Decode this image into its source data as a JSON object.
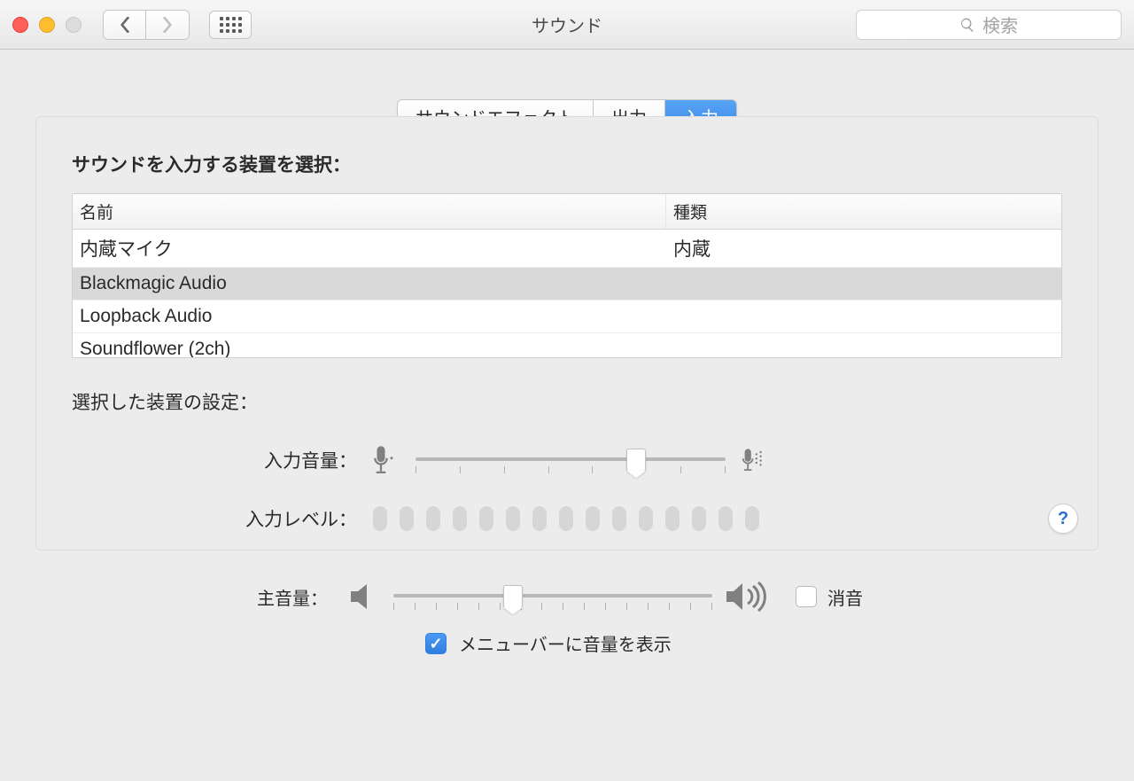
{
  "window": {
    "title": "サウンド",
    "search_placeholder": "検索"
  },
  "tabs": [
    "サウンドエフェクト",
    "出力",
    "入力"
  ],
  "active_tab_index": 2,
  "input_section": {
    "heading": "サウンドを入力する装置を選択：",
    "columns": {
      "name": "名前",
      "kind": "種類"
    },
    "devices": [
      {
        "name": "内蔵マイク",
        "kind": "内蔵"
      },
      {
        "name": "Blackmagic Audio",
        "kind": ""
      },
      {
        "name": "Loopback Audio",
        "kind": ""
      },
      {
        "name": "Soundflower (2ch)",
        "kind": ""
      }
    ],
    "selected_index": 1,
    "settings_heading": "選択した装置の設定：",
    "volume_label": "入力音量：",
    "level_label": "入力レベル："
  },
  "master": {
    "label": "主音量：",
    "mute_label": "消音",
    "menubar_label": "メニューバーに音量を表示"
  },
  "help_tooltip": "?"
}
